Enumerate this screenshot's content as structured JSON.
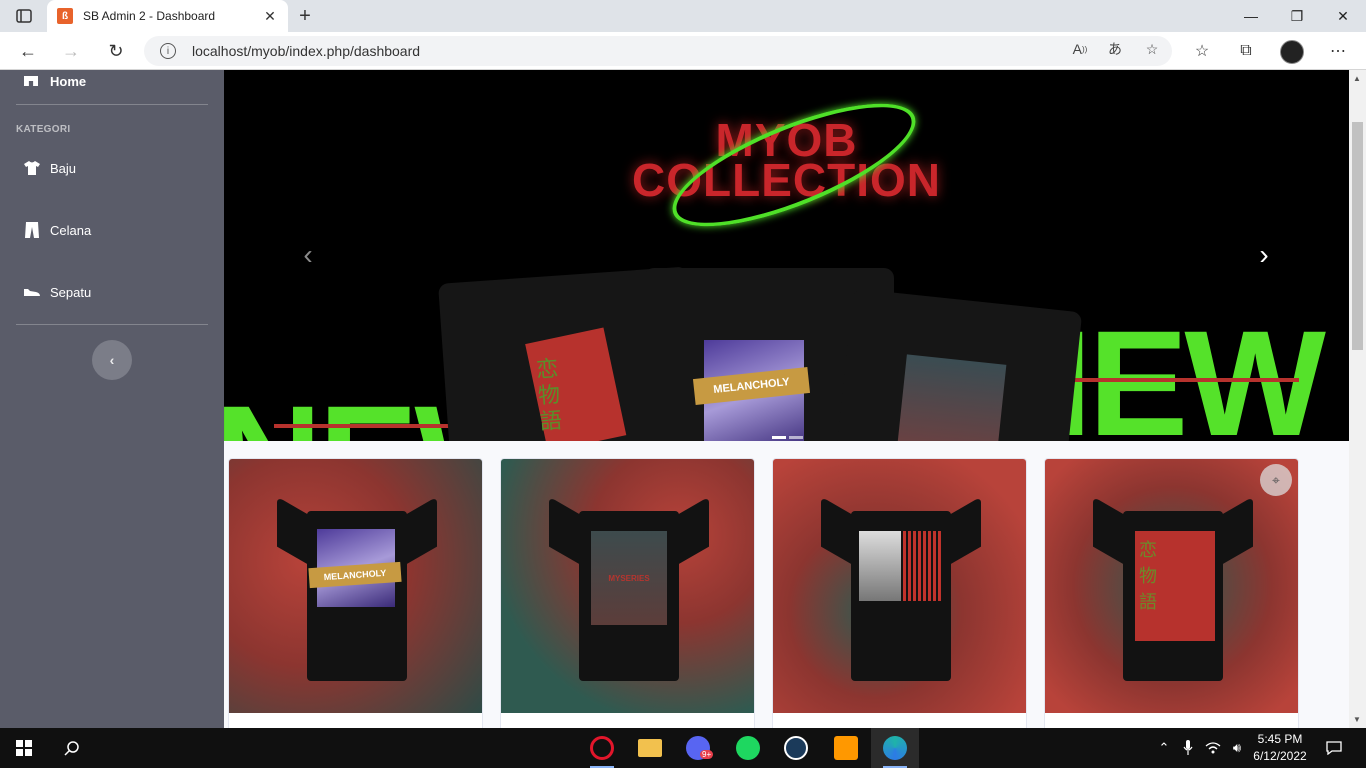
{
  "browser": {
    "tab_title": "SB Admin 2 - Dashboard",
    "tab_close": "✕",
    "new_tab": "+",
    "url": "localhost/myob/index.php/dashboard",
    "minimize": "—",
    "restore": "❐",
    "close": "✕"
  },
  "sidebar": {
    "home_label": "Home",
    "heading": "KATEGORI",
    "items": [
      {
        "label": "Baju",
        "icon": "tshirt-icon"
      },
      {
        "label": "Celana",
        "icon": "pants-icon"
      },
      {
        "label": "Sepatu",
        "icon": "shoe-icon"
      }
    ],
    "toggle_glyph": "‹"
  },
  "carousel": {
    "title_line1": "MYOB",
    "title_line2": "COLLECTION",
    "band_text": "NEW",
    "band_text_right": "NEW",
    "shirt_print_text": "MELANCHOLY",
    "shirt_print_kanji": "恋 物 語",
    "prev": "‹",
    "next": "›"
  },
  "products": [
    {
      "bg": "#b8433a",
      "print_text": "MELANCHOLY"
    },
    {
      "bg": "#2f5a50",
      "print_text": "MYSERIES"
    },
    {
      "bg": "#b8433a",
      "print_text": ""
    },
    {
      "bg": "#2f5a50",
      "print_text": "恋 物 語"
    }
  ],
  "taskbar": {
    "time": "5:45 PM",
    "date": "6/12/2022",
    "discord_badge": "9+"
  },
  "colors": {
    "sidebar": "#5a5c69",
    "accent_green": "#55e22a",
    "accent_red": "#c9262b"
  }
}
